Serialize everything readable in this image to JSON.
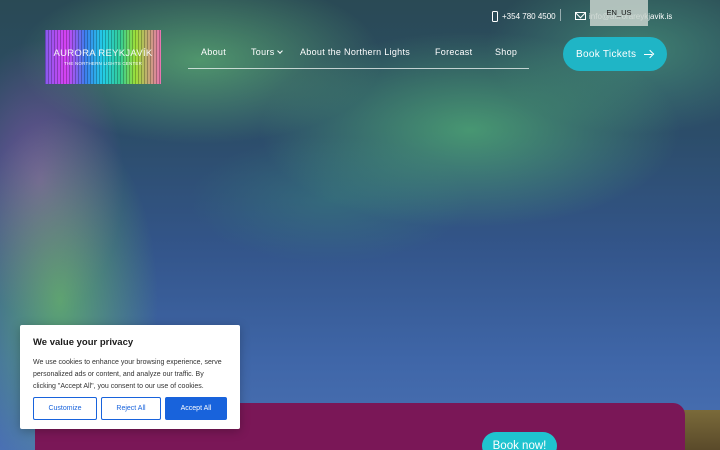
{
  "topbar": {
    "phone": "+354 780 4500",
    "email": "info@aurorareykjavik.is",
    "language": "EN_US"
  },
  "logo": {
    "title": "AURORA REYKJAVÍK",
    "subtitle": "THE NORTHERN LIGHTS CENTER"
  },
  "nav": {
    "items": [
      {
        "label": "About"
      },
      {
        "label": "Tours"
      },
      {
        "label": "About the Northern Lights"
      },
      {
        "label": "Forecast"
      },
      {
        "label": "Shop"
      }
    ]
  },
  "cta": {
    "book_tickets": "Book Tickets",
    "book_now": "Book now!"
  },
  "cookie": {
    "title": "We value your privacy",
    "text": "We use cookies to enhance your browsing experience, serve personalized ads or content, and analyze our traffic. By clicking \"Accept All\", you consent to our use of cookies.",
    "customize": "Customize",
    "reject": "Reject All",
    "accept": "Accept All"
  },
  "colors": {
    "accent": "#1fb5c6",
    "promo": "#7a1757",
    "cookie_button": "#1863dc"
  }
}
